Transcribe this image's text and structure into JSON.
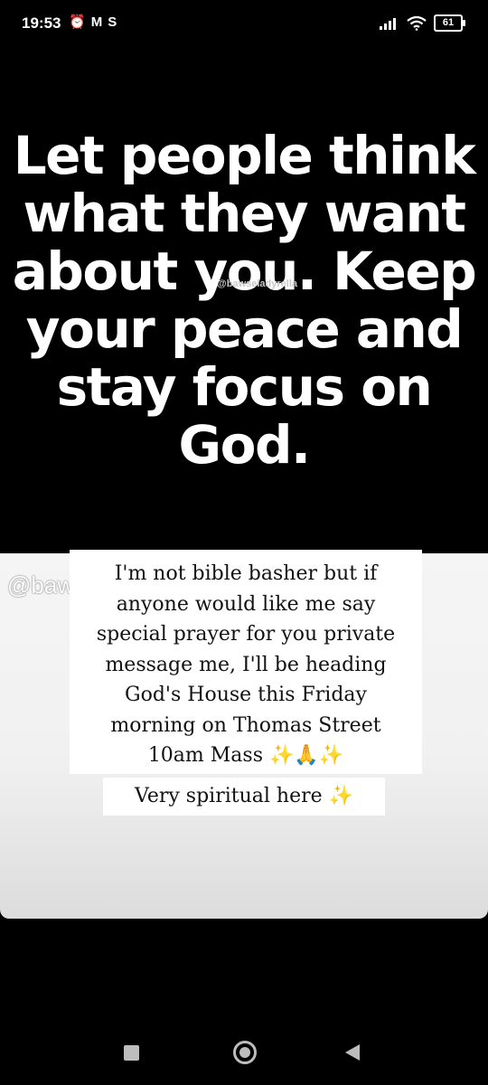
{
  "status_bar": {
    "time": "19:53",
    "alarm_icon": "alarm-clock-icon",
    "gmail_icon": "M",
    "s_icon": "S",
    "battery": "61"
  },
  "quote_image": {
    "lines": [
      "Let people think",
      "what they want",
      "about you. Keep",
      "your peace and",
      "stay focus on",
      "God."
    ],
    "watermark": "@bawseladyrella"
  },
  "story": {
    "watermark": "@baw",
    "message_lines": [
      "I'm not bible basher but if",
      "anyone would like me say",
      "special prayer for you private",
      "message me, I'll be heading",
      "God's House this Friday",
      "morning on Thomas Street",
      "10am Mass ✨🙏✨"
    ],
    "subtext": "Very spiritual here ✨"
  },
  "nav_bar": {
    "recent": "recent-apps-icon",
    "home": "home-icon",
    "back": "back-icon"
  }
}
